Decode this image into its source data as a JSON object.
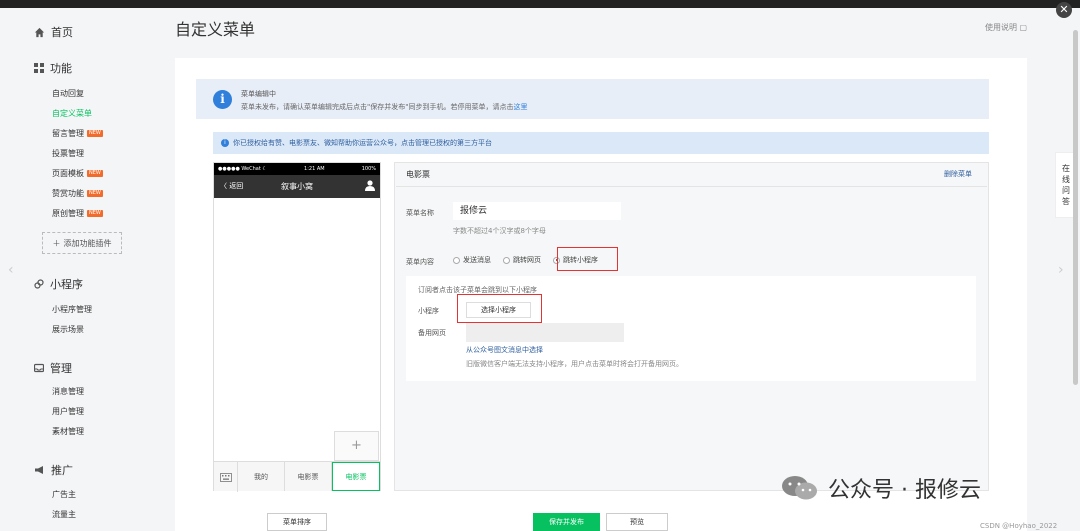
{
  "window": {
    "close_icon": "close-icon"
  },
  "sidebar": {
    "home": "首页",
    "sections": [
      {
        "label": "功能",
        "icon": "grid-icon",
        "items": [
          {
            "label": "自动回复",
            "active": false,
            "badge": false
          },
          {
            "label": "自定义菜单",
            "active": true,
            "badge": false
          },
          {
            "label": "留言管理",
            "active": false,
            "badge": true
          },
          {
            "label": "投票管理",
            "active": false,
            "badge": false
          },
          {
            "label": "页面模板",
            "active": false,
            "badge": true
          },
          {
            "label": "赞赏功能",
            "active": false,
            "badge": true
          },
          {
            "label": "原创管理",
            "active": false,
            "badge": true
          }
        ]
      },
      {
        "label": "小程序",
        "icon": "link-icon",
        "items": [
          {
            "label": "小程序管理"
          },
          {
            "label": "展示场景"
          }
        ]
      },
      {
        "label": "管理",
        "icon": "inbox-icon",
        "items": [
          {
            "label": "消息管理"
          },
          {
            "label": "用户管理"
          },
          {
            "label": "素材管理"
          }
        ]
      },
      {
        "label": "推广",
        "icon": "megaphone-icon",
        "items": [
          {
            "label": "广告主"
          },
          {
            "label": "流量主"
          }
        ]
      }
    ],
    "add_plugin": "添加功能插件",
    "new_badge": "NEW"
  },
  "header": {
    "title": "自定义菜单",
    "help": "使用说明"
  },
  "notice": {
    "title": "菜单编辑中",
    "text": "菜单未发布，请确认菜单编辑完成后点击\"保存并发布\"同步到手机。若停用菜单，请点击",
    "link": "这里",
    "auth": "你已授权给有赞、电影票友、微知帮助你运营公众号，点击管理已授权的第三方平台"
  },
  "phone": {
    "status_left": "●●●●● WeChat ☾",
    "status_time": "1:21 AM",
    "status_right": "100%",
    "back": "〈 返回",
    "account_name": "叙事小窝",
    "plus": "+",
    "menu_items": [
      "我的",
      "电影票",
      "电影票"
    ]
  },
  "editor": {
    "title": "电影票",
    "delete": "删除菜单",
    "name_label": "菜单名称",
    "name_value": "报修云",
    "name_hint": "字数不超过4个汉字或8个字母",
    "content_label": "菜单内容",
    "options": [
      "发送消息",
      "跳转网页",
      "跳转小程序"
    ],
    "selected_option": 2,
    "sub_hint": "订阅者点击该子菜单会跳到以下小程序",
    "miniprogram_label": "小程序",
    "select_button": "选择小程序",
    "backup_label": "备用网页",
    "backup_hint": "从公众号图文消息中选择",
    "compat_hint": "旧版微信客户端无法支持小程序，用户点击菜单时将会打开备用网页。"
  },
  "footer": {
    "sort": "菜单排序",
    "save": "保存并发布",
    "preview": "预览"
  },
  "right_tab": [
    "在",
    "线",
    "问",
    "答"
  ],
  "watermark": {
    "text": "公众号 · 报修云",
    "csdn": "CSDN @Hoyhao_2022"
  },
  "colors": {
    "accent": "#07c160",
    "link": "#2f7fdb",
    "highlight": "#e53333"
  }
}
